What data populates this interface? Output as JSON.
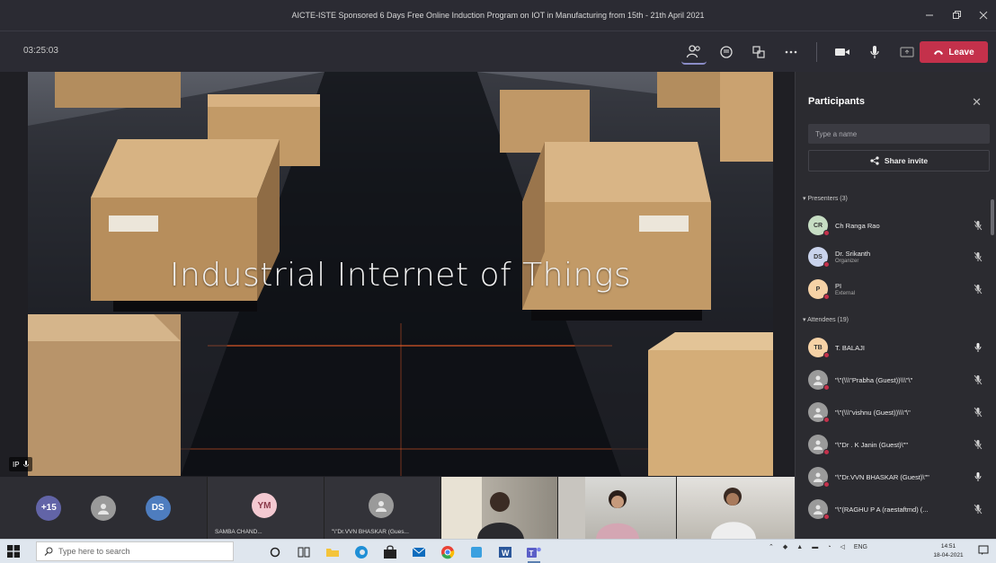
{
  "window": {
    "title": "AICTE-ISTE Sponsored 6 Days Free Online Induction Program on IOT in Manufacturing from 15th - 21th April 2021",
    "controls": [
      "minimize-icon",
      "maximize-icon",
      "close-icon"
    ]
  },
  "meeting": {
    "timer": "03:25:03",
    "toolbar_icons": [
      "participants-icon",
      "chat-icon",
      "rooms-icon",
      "more-options-icon",
      "camera-icon",
      "microphone-icon",
      "share-screen-icon"
    ],
    "leave_label": "Leave",
    "leave_color": "#c4314b"
  },
  "stage": {
    "slide_title": "Industrial Internet of Things",
    "presenter_initials": "IP"
  },
  "gallery": {
    "overflow_count": "+15",
    "group_initials": "DS",
    "tiles": [
      {
        "initials": "YM",
        "name": "SAMBA CHAND...",
        "color": "#f3c9d1"
      },
      {
        "initials": "",
        "name": "\"\\\"Dr.VVN BHASKAR (Gues...",
        "color": "#9a9a9a"
      }
    ]
  },
  "participants": {
    "title": "Participants",
    "search_placeholder": "Type a name",
    "share_invite_label": "Share invite",
    "presenters_header": "Presenters (3)",
    "attendees_header": "Attendees (19)",
    "presenters": [
      {
        "initials": "CR",
        "name": "Ch Ranga Rao",
        "role": "",
        "color": "#c6ddc3"
      },
      {
        "initials": "DS",
        "name": "Dr. Srikanth",
        "role": "Organizer",
        "color": "#c9d3ec"
      },
      {
        "initials": "P",
        "name": "PI",
        "role": "External",
        "color": "#f6d2a6"
      }
    ],
    "attendees": [
      {
        "initials": "TB",
        "name": "T. BALAJI",
        "color": "#f6d2a6"
      },
      {
        "initials": "",
        "name": "\"\\\"(\\\\\\\"Prabha (Guest))\\\\\\\"\\\"",
        "color": "#9a9a9a"
      },
      {
        "initials": "",
        "name": "\"\\\"(\\\\\\\"vishnu (Guest))\\\\\\\"\\\"",
        "color": "#9a9a9a"
      },
      {
        "initials": "",
        "name": "\"\\\"Dr . K Janin (Guest)\\\"\"",
        "color": "#9a9a9a"
      },
      {
        "initials": "",
        "name": "\"\\\"Dr.VVN BHASKAR (Guest)\\\"\"",
        "color": "#9a9a9a"
      },
      {
        "initials": "",
        "name": "\"\\\"(RAGHU P A (raestaftmd) (...",
        "color": "#9a9a9a"
      }
    ]
  },
  "taskbar": {
    "search_placeholder": "Type here to search",
    "language": "ENG",
    "time": "14:51",
    "date": "18-04-2021"
  }
}
